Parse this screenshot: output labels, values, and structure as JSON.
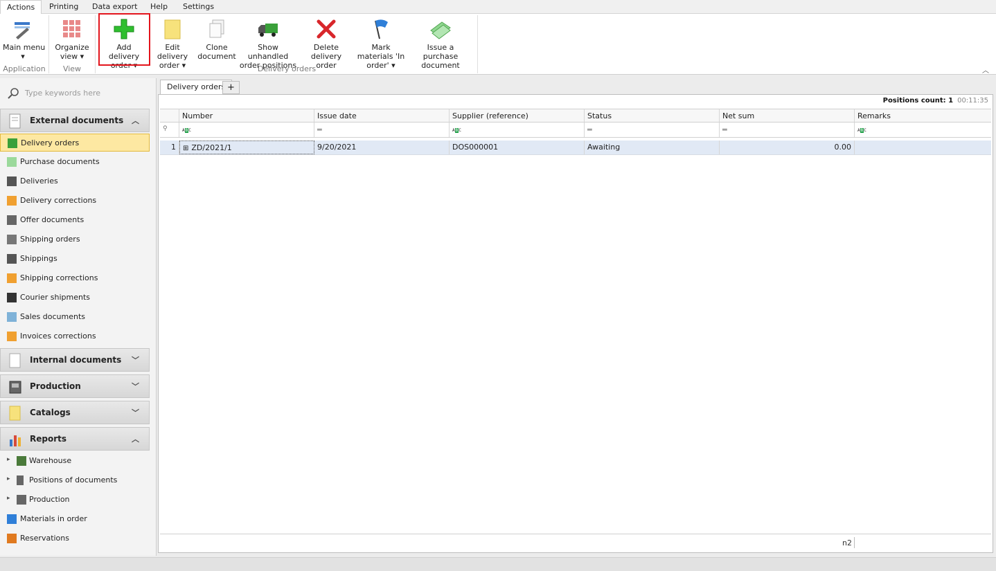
{
  "menu": {
    "tabs": [
      "Actions",
      "Printing",
      "Data export",
      "Help",
      "Settings"
    ],
    "active": "Actions"
  },
  "ribbon": {
    "buttons": {
      "main_menu": "Main menu",
      "organize_view": "Organize view",
      "add_delivery_order": "Add delivery order",
      "edit_delivery_order": "Edit delivery order",
      "clone_document": "Clone document",
      "show_unhandled": "Show unhandled order positions",
      "delete_delivery_order": "Delete delivery order",
      "mark_materials": "Mark materials 'In order'",
      "issue_purchase": "Issue a purchase document"
    },
    "groups": {
      "application": "Application",
      "view": "View",
      "delivery_orders": "Delivery orders"
    },
    "highlight_color": "#e3141c"
  },
  "sidebar": {
    "search_placeholder": "Type keywords here",
    "groups": {
      "external": "External documents",
      "internal": "Internal documents",
      "production": "Production",
      "catalogs": "Catalogs",
      "reports": "Reports"
    },
    "external_items": [
      "Delivery orders",
      "Purchase documents",
      "Deliveries",
      "Delivery corrections",
      "Offer documents",
      "Shipping orders",
      "Shippings",
      "Shipping corrections",
      "Courier shipments",
      "Sales documents",
      "Invoices corrections"
    ],
    "report_items": [
      "Warehouse",
      "Positions of documents",
      "Production",
      "Materials in order",
      "Reservations"
    ],
    "active_item": "Delivery orders",
    "active_color": "#fde8a2"
  },
  "main": {
    "tab_label": "Delivery orders",
    "add_tab_label": "+",
    "positions_count_label": "Positions count: 1",
    "elapsed": "00:11:35",
    "columns": [
      "Number",
      "Issue date",
      "Supplier (reference)",
      "Status",
      "Net sum",
      "Remarks"
    ],
    "rows": [
      {
        "index": "1",
        "number": "ZD/2021/1",
        "issue_date": "9/20/2021",
        "supplier": "DOS000001",
        "status": "Awaiting",
        "net_sum": "0.00",
        "remarks": ""
      }
    ],
    "footer_label": "n2"
  }
}
